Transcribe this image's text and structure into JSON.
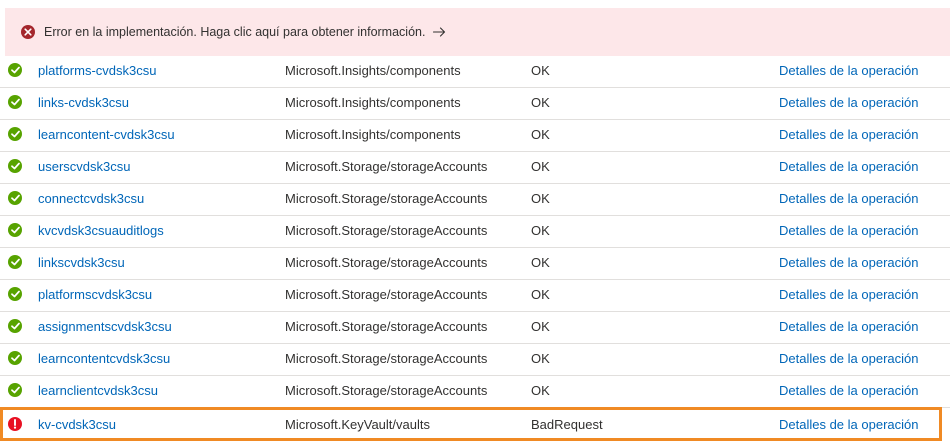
{
  "banner": {
    "icon": "error-circle-icon",
    "message": "Error en la implementación. Haga clic aquí para obtener información.",
    "arrow_icon": "arrow-right-icon",
    "color": "#a4262c",
    "background": "#fde7e9"
  },
  "colors": {
    "ok": "#57a300",
    "error": "#e81123",
    "link": "#0066b8",
    "highlight": "#f08a24"
  },
  "rows": [
    {
      "status_icon": "check-circle-icon",
      "name": "platforms-cvdsk3csu",
      "type": "Microsoft.Insights/components",
      "status": "OK",
      "link": "Detalles de la operación"
    },
    {
      "status_icon": "check-circle-icon",
      "name": "links-cvdsk3csu",
      "type": "Microsoft.Insights/components",
      "status": "OK",
      "link": "Detalles de la operación"
    },
    {
      "status_icon": "check-circle-icon",
      "name": "learncontent-cvdsk3csu",
      "type": "Microsoft.Insights/components",
      "status": "OK",
      "link": "Detalles de la operación"
    },
    {
      "status_icon": "check-circle-icon",
      "name": "userscvdsk3csu",
      "type": "Microsoft.Storage/storageAccounts",
      "status": "OK",
      "link": "Detalles de la operación"
    },
    {
      "status_icon": "check-circle-icon",
      "name": "connectcvdsk3csu",
      "type": "Microsoft.Storage/storageAccounts",
      "status": "OK",
      "link": "Detalles de la operación"
    },
    {
      "status_icon": "check-circle-icon",
      "name": "kvcvdsk3csuauditlogs",
      "type": "Microsoft.Storage/storageAccounts",
      "status": "OK",
      "link": "Detalles de la operación"
    },
    {
      "status_icon": "check-circle-icon",
      "name": "linkscvdsk3csu",
      "type": "Microsoft.Storage/storageAccounts",
      "status": "OK",
      "link": "Detalles de la operación"
    },
    {
      "status_icon": "check-circle-icon",
      "name": "platformscvdsk3csu",
      "type": "Microsoft.Storage/storageAccounts",
      "status": "OK",
      "link": "Detalles de la operación"
    },
    {
      "status_icon": "check-circle-icon",
      "name": "assignmentscvdsk3csu",
      "type": "Microsoft.Storage/storageAccounts",
      "status": "OK",
      "link": "Detalles de la operación"
    },
    {
      "status_icon": "check-circle-icon",
      "name": "learncontentcvdsk3csu",
      "type": "Microsoft.Storage/storageAccounts",
      "status": "OK",
      "link": "Detalles de la operación"
    },
    {
      "status_icon": "check-circle-icon",
      "name": "learnclientcvdsk3csu",
      "type": "Microsoft.Storage/storageAccounts",
      "status": "OK",
      "link": "Detalles de la operación"
    },
    {
      "status_icon": "error-exclamation-icon",
      "name": "kv-cvdsk3csu",
      "type": "Microsoft.KeyVault/vaults",
      "status": "BadRequest",
      "link": "Detalles de la operación"
    }
  ]
}
